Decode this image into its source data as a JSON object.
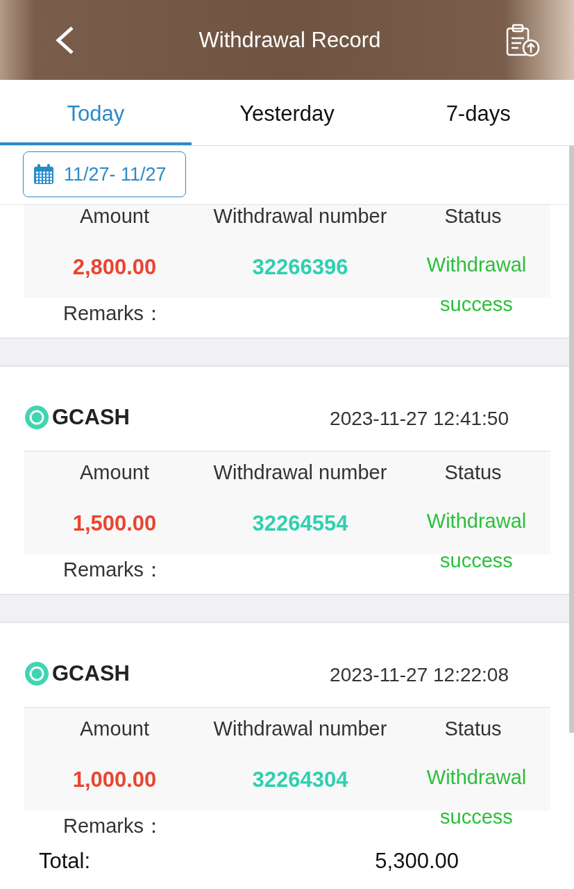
{
  "header": {
    "title": "Withdrawal Record"
  },
  "tabs": [
    {
      "label": "Today",
      "selected": true
    },
    {
      "label": "Yesterday",
      "selected": false
    },
    {
      "label": "7-days",
      "selected": false
    }
  ],
  "date_range": "11/27- 11/27",
  "records": [
    {
      "columns": [
        "Amount",
        "Withdrawal number",
        "Status"
      ],
      "amount": "2,800.00",
      "number": "32266396",
      "status": "Withdrawal success",
      "remarks": "Remarks："
    },
    {
      "method": "GCASH",
      "time": "2023-11-27 12:41:50",
      "columns": [
        "Amount",
        "Withdrawal number",
        "Status"
      ],
      "amount": "1,500.00",
      "number": "32264554",
      "status": "Withdrawal success",
      "remarks": "Remarks："
    },
    {
      "method": "GCASH",
      "time": "2023-11-27 12:22:08",
      "columns": [
        "Amount",
        "Withdrawal number",
        "Status"
      ],
      "amount": "1,000.00",
      "number": "32264304",
      "status": "Withdrawal success",
      "remarks": "Remarks："
    }
  ],
  "footer": {
    "label": "Total:",
    "value": "5,300.00"
  }
}
